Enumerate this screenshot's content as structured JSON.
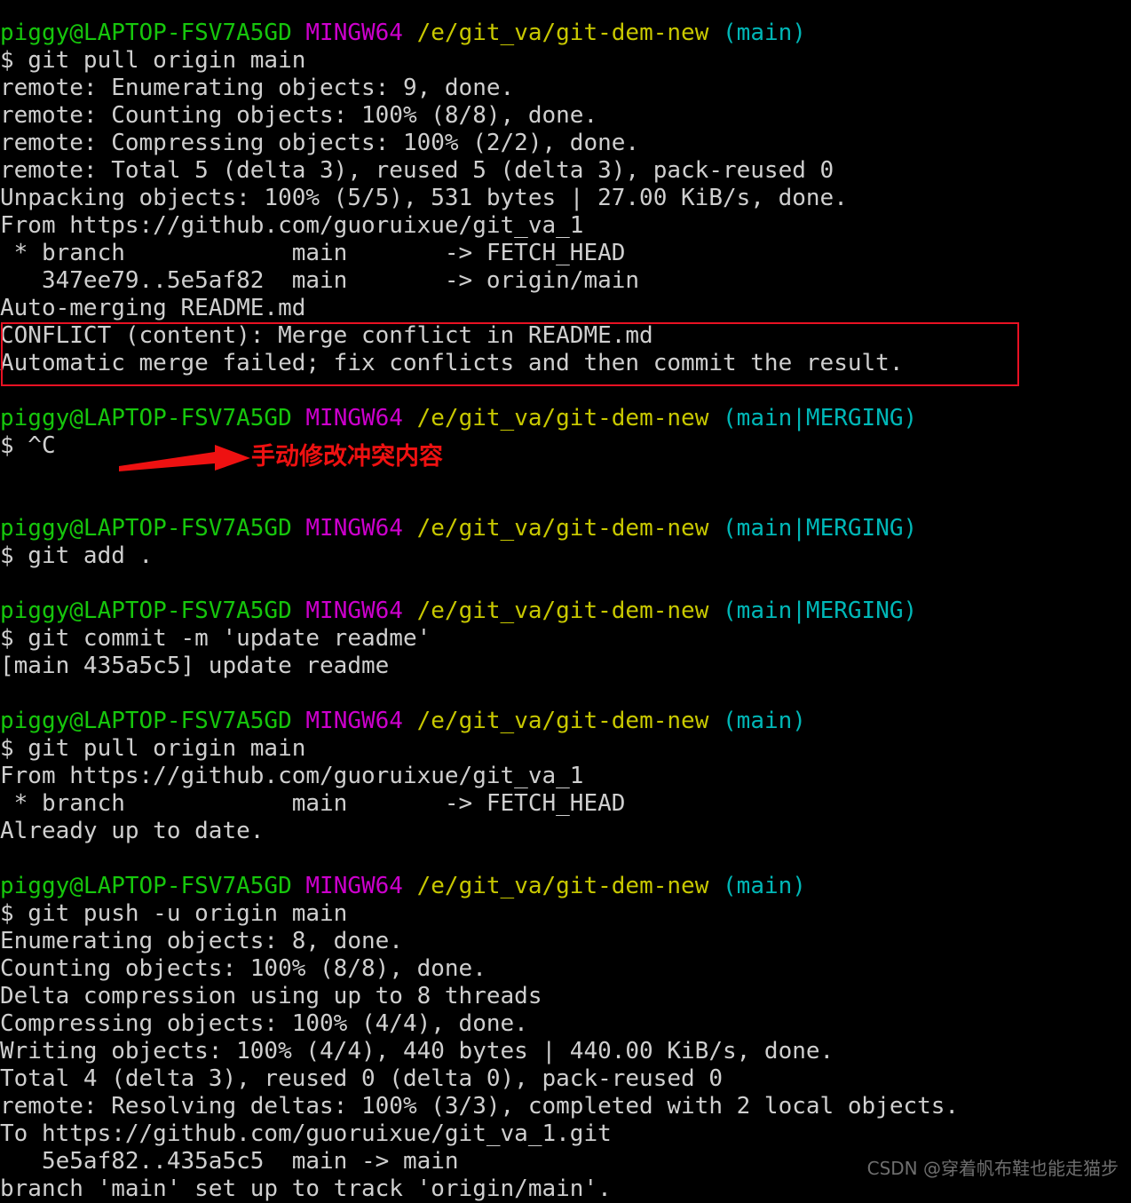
{
  "terminal": {
    "shell": "MINGW64",
    "prompt": {
      "user_host": "piggy@LAPTOP-FSV7A5GD",
      "shell_tag": "MINGW64",
      "path": "/e/git_va/git-dem-new",
      "branch_main": "(main)",
      "branch_merging": "(main|MERGING)",
      "sigil": "$ "
    },
    "colors": {
      "background": "#000000",
      "output_text": "#cfcfcf",
      "user_host": "#16c60c",
      "shell_tag": "#cc00cc",
      "path": "#c8c800",
      "branch": "#00b7b7",
      "annotation": "#ee1111",
      "highlight_box": "#e81123",
      "watermark": "#6e6e6e"
    },
    "lines": [
      {
        "type": "prompt",
        "branch": "(main)"
      },
      {
        "type": "command",
        "text": "$ git pull origin main"
      },
      {
        "type": "output",
        "text": "remote: Enumerating objects: 9, done."
      },
      {
        "type": "output",
        "text": "remote: Counting objects: 100% (8/8), done."
      },
      {
        "type": "output",
        "text": "remote: Compressing objects: 100% (2/2), done."
      },
      {
        "type": "output",
        "text": "remote: Total 5 (delta 3), reused 5 (delta 3), pack-reused 0"
      },
      {
        "type": "output",
        "text": "Unpacking objects: 100% (5/5), 531 bytes | 27.00 KiB/s, done."
      },
      {
        "type": "output",
        "text": "From https://github.com/guoruixue/git_va_1"
      },
      {
        "type": "output",
        "text": " * branch            main       -> FETCH_HEAD"
      },
      {
        "type": "output",
        "text": "   347ee79..5e5af82  main       -> origin/main"
      },
      {
        "type": "output",
        "text": "Auto-merging README.md"
      },
      {
        "type": "output",
        "text": "CONFLICT (content): Merge conflict in README.md"
      },
      {
        "type": "output",
        "text": "Automatic merge failed; fix conflicts and then commit the result."
      },
      {
        "type": "blank",
        "text": ""
      },
      {
        "type": "prompt",
        "branch": "(main|MERGING)"
      },
      {
        "type": "command",
        "text": "$ ^C"
      },
      {
        "type": "blank",
        "text": ""
      },
      {
        "type": "blank",
        "text": ""
      },
      {
        "type": "prompt",
        "branch": "(main|MERGING)"
      },
      {
        "type": "command",
        "text": "$ git add ."
      },
      {
        "type": "blank",
        "text": ""
      },
      {
        "type": "prompt",
        "branch": "(main|MERGING)"
      },
      {
        "type": "command",
        "text": "$ git commit -m 'update readme'"
      },
      {
        "type": "output",
        "text": "[main 435a5c5] update readme"
      },
      {
        "type": "blank",
        "text": ""
      },
      {
        "type": "prompt",
        "branch": "(main)"
      },
      {
        "type": "command",
        "text": "$ git pull origin main"
      },
      {
        "type": "output",
        "text": "From https://github.com/guoruixue/git_va_1"
      },
      {
        "type": "output",
        "text": " * branch            main       -> FETCH_HEAD"
      },
      {
        "type": "output",
        "text": "Already up to date."
      },
      {
        "type": "blank",
        "text": ""
      },
      {
        "type": "prompt",
        "branch": "(main)"
      },
      {
        "type": "command",
        "text": "$ git push -u origin main"
      },
      {
        "type": "output",
        "text": "Enumerating objects: 8, done."
      },
      {
        "type": "output",
        "text": "Counting objects: 100% (8/8), done."
      },
      {
        "type": "output",
        "text": "Delta compression using up to 8 threads"
      },
      {
        "type": "output",
        "text": "Compressing objects: 100% (4/4), done."
      },
      {
        "type": "output",
        "text": "Writing objects: 100% (4/4), 440 bytes | 440.00 KiB/s, done."
      },
      {
        "type": "output",
        "text": "Total 4 (delta 3), reused 0 (delta 0), pack-reused 0"
      },
      {
        "type": "output",
        "text": "remote: Resolving deltas: 100% (3/3), completed with 2 local objects."
      },
      {
        "type": "output",
        "text": "To https://github.com/guoruixue/git_va_1.git"
      },
      {
        "type": "output",
        "text": "   5e5af82..435a5c5  main -> main"
      },
      {
        "type": "output",
        "text": "branch 'main' set up to track 'origin/main'."
      }
    ]
  },
  "annotations": {
    "conflict_highlight_label": "merge-conflict-highlight",
    "arrow_label": "annotation-arrow",
    "text": "手动修改冲突内容"
  },
  "watermark": {
    "text": "CSDN @穿着帆布鞋也能走猫步"
  }
}
